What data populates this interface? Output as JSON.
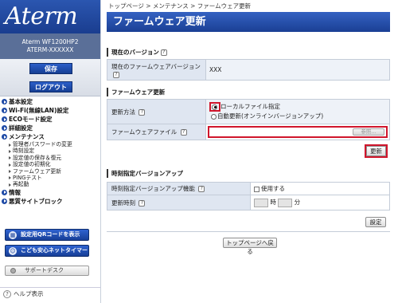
{
  "sidebar": {
    "logo": "Aterm",
    "model": "Aterm  WF1200HP2",
    "device_id": "ATERM-XXXXXX",
    "save_label": "保存",
    "logout_label": "ログアウト",
    "menu": [
      {
        "label": "基本設定"
      },
      {
        "label": "Wi-Fi(無線LAN)設定"
      },
      {
        "label": "ECOモード設定"
      },
      {
        "label": "詳細設定"
      },
      {
        "label": "メンテナンス"
      }
    ],
    "maintenance_items": [
      "管理者パスワードの変更",
      "時刻設定",
      "設定値の保存＆復元",
      "設定値の初期化",
      "ファームウェア更新",
      "PINGテスト",
      "再起動"
    ],
    "info_label": "情報",
    "block_label": "悪質サイトブロック",
    "qr_label": "設定用QRコードを表示",
    "kids_label": "こども安心ネットタイマー",
    "support_label": "サポートデスク",
    "help_label": "ヘルプ表示"
  },
  "breadcrumb": "トップページ > メンテナンス > ファームウェア更新",
  "title": "ファームウェア更新",
  "current_version": {
    "section_title": "現在のバージョン",
    "label": "現在のファームウェアバージョン",
    "value": "XXX"
  },
  "firmware_update": {
    "section_title": "ファームウェア更新",
    "method_label": "更新方法",
    "option_local": "ローカルファイル指定",
    "option_auto": "自動更新(オンラインバージョンアップ)",
    "selected": "local",
    "file_label": "ファームウェアファイル",
    "browse_label": "参照...",
    "update_button": "更新"
  },
  "scheduled": {
    "section_title": "時刻指定バージョンアップ",
    "feature_label": "時刻指定バージョンアップ機能",
    "use_label": "使用する",
    "time_label": "更新時刻",
    "hour_unit": "時",
    "minute_unit": "分",
    "set_button": "設定"
  },
  "back_button": "トップページへ戻る",
  "help_glyph": "?",
  "colors": {
    "brand_blue": "#1a3f94",
    "highlight_red": "#d0162c"
  }
}
